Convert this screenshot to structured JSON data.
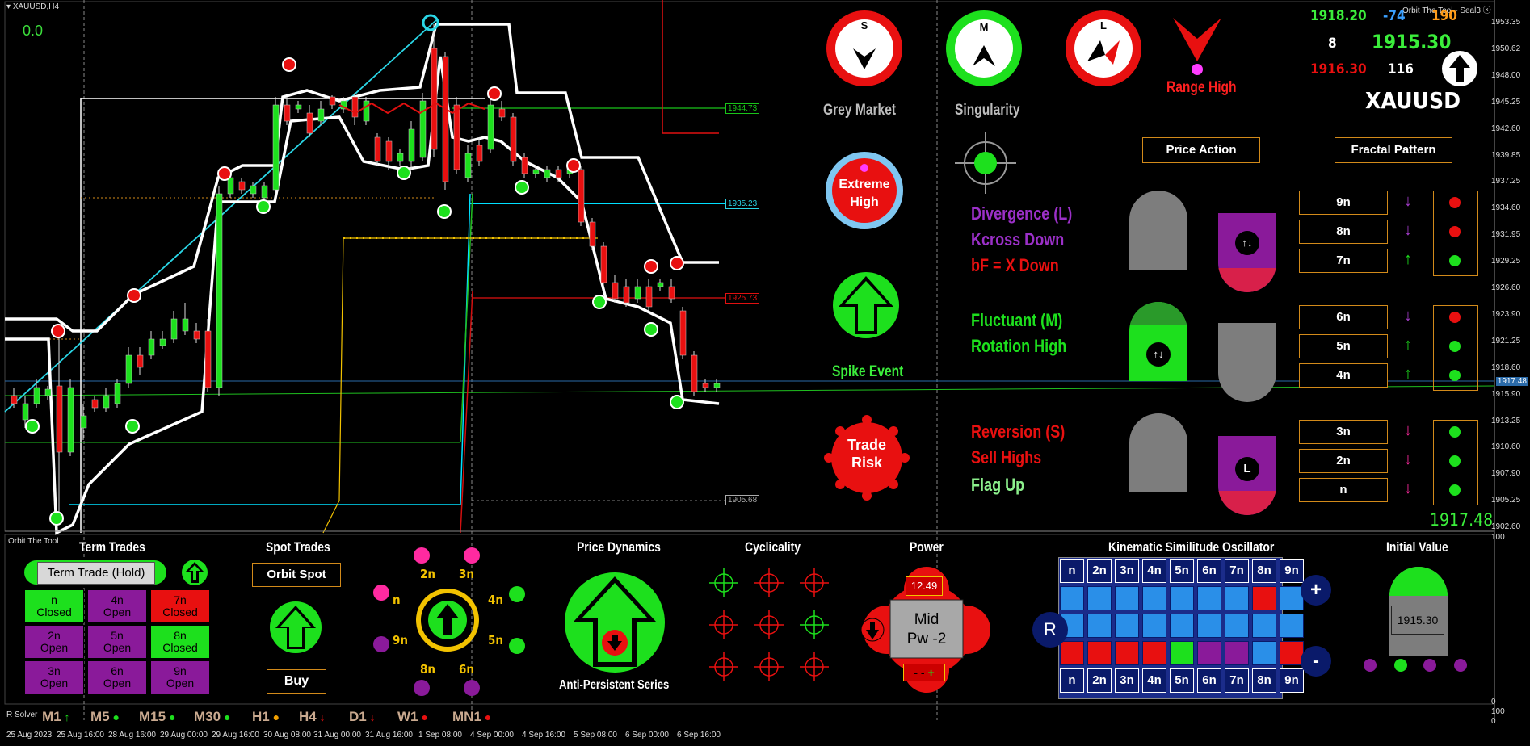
{
  "window": {
    "symbol_title": "XAUUSD,H4",
    "indicator_title": "Orbit The Tool - Seal3"
  },
  "chart_top_left_value": "0.0",
  "price_levels": {
    "l1": "1944.73",
    "l2": "1935.23",
    "l3": "1925.73",
    "l4": "1905.68",
    "current": "1917.48"
  },
  "price_axis": [
    "1953.35",
    "1950.62",
    "1948.00",
    "1945.25",
    "1942.60",
    "1939.85",
    "1937.25",
    "1934.60",
    "1931.95",
    "1929.25",
    "1926.60",
    "1923.90",
    "1921.25",
    "1918.60",
    "1915.90",
    "1913.25",
    "1910.60",
    "1907.90",
    "1905.25",
    "1902.60"
  ],
  "osc_axis": {
    "top": "100",
    "zero": "0",
    "right_top": "100",
    "right_bottom": "0"
  },
  "date_axis": [
    "25 Aug 2023",
    "25 Aug 16:00",
    "28 Aug 16:00",
    "29 Aug 00:00",
    "29 Aug 16:00",
    "30 Aug 08:00",
    "31 Aug 00:00",
    "31 Aug 16:00",
    "1 Sep 08:00",
    "4 Sep 00:00",
    "4 Sep 16:00",
    "5 Sep 08:00",
    "6 Sep 00:00",
    "6 Sep 16:00"
  ],
  "top_indicators": {
    "s": {
      "letter": "S",
      "caption": "Grey Market"
    },
    "m": {
      "letter": "M",
      "caption": "Singularity"
    },
    "l": {
      "letter": "L"
    },
    "range": {
      "caption": "Range High"
    },
    "extreme": {
      "line1": "Extreme",
      "line2": "High"
    },
    "spike": {
      "caption": "Spike Event"
    },
    "risk": {
      "line1": "Trade",
      "line2": "Risk"
    }
  },
  "price_panel": {
    "v1": "1918.20",
    "v2": "-74",
    "v3": "190",
    "v4": "8",
    "v5": "1915.30",
    "v6": "1916.30",
    "v7": "116",
    "symbol": "XAUUSD",
    "big_value": "1917.48"
  },
  "buttons": {
    "price_action": "Price Action",
    "fractal_pattern": "Fractal Pattern"
  },
  "signals": {
    "l": [
      "Divergence (L)",
      "Kcross Down",
      "bF = X Down"
    ],
    "m": [
      "Fluctuant (M)",
      "Rotation High"
    ],
    "s": [
      "Reversion (S)",
      "Sell Highs",
      "Flag Up"
    ]
  },
  "fractals": [
    "9n",
    "8n",
    "7n",
    "6n",
    "5n",
    "4n",
    "3n",
    "2n",
    "n"
  ],
  "bottom": {
    "panel_title": "Orbit The Tool",
    "term_trades": {
      "title": "Term Trades",
      "hold": "Term Trade (Hold)",
      "cells": [
        [
          "n",
          "Closed"
        ],
        [
          "4n",
          "Open"
        ],
        [
          "7n",
          "Closed"
        ],
        [
          "2n",
          "Open"
        ],
        [
          "5n",
          "Open"
        ],
        [
          "8n",
          "Closed"
        ],
        [
          "3n",
          "Open"
        ],
        [
          "6n",
          "Open"
        ],
        [
          "9n",
          "Open"
        ]
      ]
    },
    "spot_trades": {
      "title": "Spot Trades",
      "orbit_spot": "Orbit Spot",
      "action": "Buy"
    },
    "orbit_labels": [
      "2n",
      "3n",
      "4n",
      "5n",
      "6n",
      "8n",
      "9n",
      "n"
    ],
    "price_dynamics": {
      "title": "Price Dynamics",
      "caption": "Anti-Persistent Series"
    },
    "cyclicality": {
      "title": "Cyclicality"
    },
    "power": {
      "title": "Power",
      "value": "12.49",
      "mid": "Mid",
      "pw": "Pw -2"
    },
    "kso": {
      "title": "Kinematic Similitude Oscillator",
      "labels": [
        "n",
        "2n",
        "3n",
        "4n",
        "5n",
        "6n",
        "7n",
        "8n",
        "9n"
      ],
      "r": "R",
      "plus": "+",
      "minus": "-"
    },
    "initial": {
      "title": "Initial Value",
      "value": "1915.30"
    },
    "solver": "R Solver"
  },
  "timeframes": [
    "M1",
    "M5",
    "M15",
    "M30",
    "H1",
    "H4",
    "D1",
    "W1",
    "MN1"
  ]
}
